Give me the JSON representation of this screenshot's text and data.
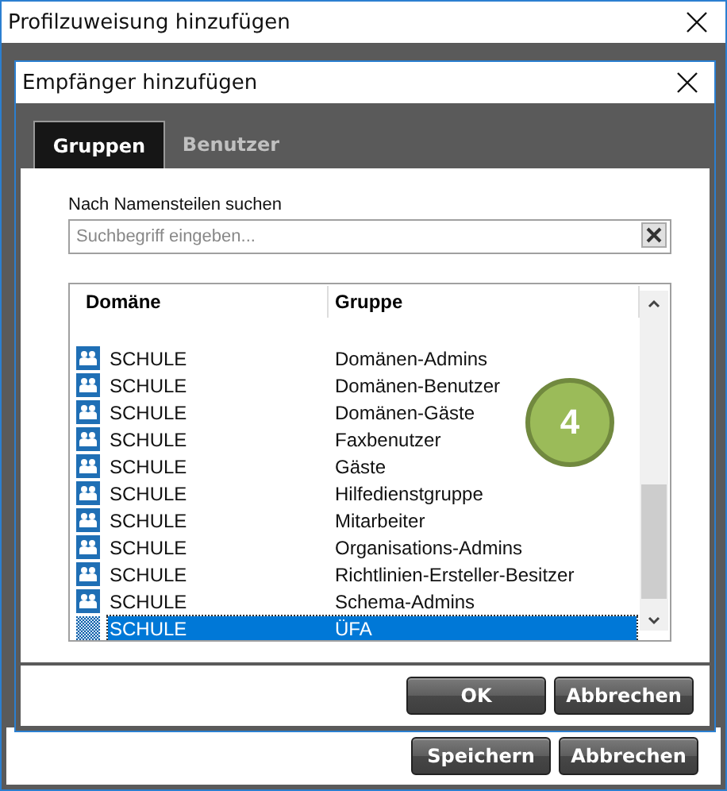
{
  "outer_window": {
    "title": "Profilzuweisung hinzufügen",
    "buttons": [
      "Speichern",
      "Abbrechen"
    ]
  },
  "dialog": {
    "title": "Empfänger hinzufügen",
    "tabs": [
      {
        "label": "Gruppen",
        "selected": true
      },
      {
        "label": "Benutzer",
        "selected": false
      }
    ],
    "search": {
      "label": "Nach Namensteilen suchen",
      "placeholder": "Suchbegriff eingeben..."
    },
    "table": {
      "columns": [
        "Domäne",
        "Gruppe"
      ],
      "rows": [
        {
          "domain": "SCHULE",
          "group": "Domänen-Admins",
          "selected": false
        },
        {
          "domain": "SCHULE",
          "group": "Domänen-Benutzer",
          "selected": false
        },
        {
          "domain": "SCHULE",
          "group": "Domänen-Gäste",
          "selected": false
        },
        {
          "domain": "SCHULE",
          "group": "Faxbenutzer",
          "selected": false
        },
        {
          "domain": "SCHULE",
          "group": "Gäste",
          "selected": false
        },
        {
          "domain": "SCHULE",
          "group": "Hilfedienstgruppe",
          "selected": false
        },
        {
          "domain": "SCHULE",
          "group": "Mitarbeiter",
          "selected": false
        },
        {
          "domain": "SCHULE",
          "group": "Organisations-Admins",
          "selected": false
        },
        {
          "domain": "SCHULE",
          "group": "Richtlinien-Ersteller-Besitzer",
          "selected": false
        },
        {
          "domain": "SCHULE",
          "group": "Schema-Admins",
          "selected": false
        },
        {
          "domain": "SCHULE",
          "group": "ÜFA",
          "selected": true
        }
      ]
    },
    "buttons": [
      "OK",
      "Abbrechen"
    ]
  },
  "badge": "4"
}
